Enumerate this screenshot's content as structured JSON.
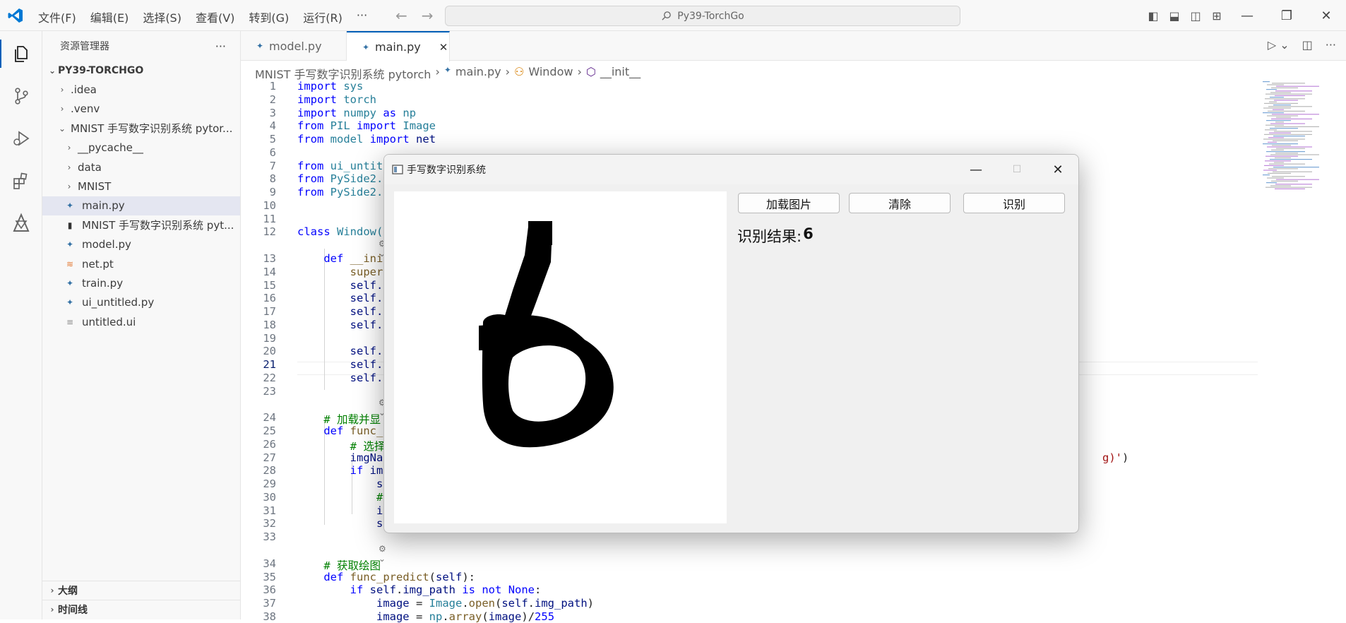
{
  "menu": [
    "文件(F)",
    "编辑(E)",
    "选择(S)",
    "查看(V)",
    "转到(G)",
    "运行(R)",
    "···"
  ],
  "search": {
    "text": "Py39-TorchGo"
  },
  "sidebar": {
    "title": "资源管理器",
    "root": "PY39-TORCHGO",
    "items": [
      {
        "label": ".idea",
        "level": 1,
        "type": "folder"
      },
      {
        "label": ".venv",
        "level": 1,
        "type": "folder"
      },
      {
        "label": "MNIST 手写数字识别系统 pytor...",
        "level": 1,
        "type": "folder-open"
      },
      {
        "label": "__pycache__",
        "level": 2,
        "type": "folder"
      },
      {
        "label": "data",
        "level": 2,
        "type": "folder"
      },
      {
        "label": "MNIST",
        "level": 2,
        "type": "folder"
      },
      {
        "label": "main.py",
        "level": 2,
        "type": "py",
        "selected": true
      },
      {
        "label": "MNIST 手写数字识别系统 pyt...",
        "level": 2,
        "type": "doc"
      },
      {
        "label": "model.py",
        "level": 2,
        "type": "py"
      },
      {
        "label": "net.pt",
        "level": 2,
        "type": "rss"
      },
      {
        "label": "train.py",
        "level": 2,
        "type": "py"
      },
      {
        "label": "ui_untitled.py",
        "level": 2,
        "type": "py"
      },
      {
        "label": "untitled.ui",
        "level": 2,
        "type": "txt"
      }
    ],
    "outline": "大纲",
    "timeline": "时间线"
  },
  "tabs": [
    {
      "label": "model.py",
      "active": false
    },
    {
      "label": "main.py",
      "active": true
    }
  ],
  "breadcrumb": [
    "MNIST 手写数字识别系统 pytorch",
    "main.py",
    "Window",
    "__init__"
  ],
  "editor": {
    "lines": [
      "1",
      "2",
      "3",
      "4",
      "5",
      "6",
      "7",
      "8",
      "9",
      "10",
      "11",
      "12",
      "13",
      "14",
      "15",
      "16",
      "17",
      "18",
      "19",
      "20",
      "21",
      "22",
      "23",
      "24",
      "25",
      "26",
      "27",
      "28",
      "29",
      "30",
      "31",
      "32",
      "33",
      "34",
      "35",
      "36",
      "37",
      "38"
    ],
    "current_line": "21"
  },
  "app": {
    "title": "手写数字识别系统",
    "buttons": {
      "load": "加载图片",
      "clear": "清除",
      "recognize": "识别"
    },
    "result_label": "识别结果:",
    "result_value": "6"
  }
}
